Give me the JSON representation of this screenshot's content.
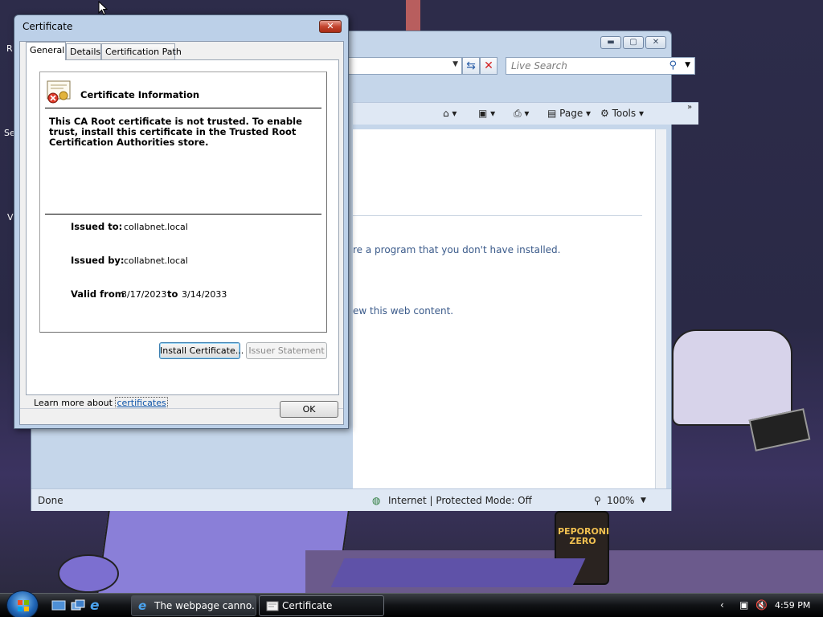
{
  "desktop": {
    "icon_labels": [
      "R",
      "Se",
      "V"
    ],
    "can_label": "PEPORONI ZERO"
  },
  "ie": {
    "search_placeholder": "Live Search",
    "commands": {
      "page": "Page",
      "tools": "Tools"
    },
    "content_lines": [
      "re a program that you don't have installed.",
      "ew this web content."
    ],
    "status": {
      "text": "Done",
      "zone": "Internet | Protected Mode: Off",
      "zoom": "100%"
    }
  },
  "certificate": {
    "title": "Certificate",
    "tabs": [
      "General",
      "Details",
      "Certification Path"
    ],
    "active_tab": "General",
    "heading": "Certificate Information",
    "warning": "This CA Root certificate is not trusted. To enable trust, install this certificate in the Trusted Root Certification Authorities store.",
    "issued_to_label": "Issued to:",
    "issued_to": "collabnet.local",
    "issued_by_label": "Issued by:",
    "issued_by": "collabnet.local",
    "valid_from_label": "Valid from",
    "valid_from": "3/17/2023",
    "valid_to_label": "to",
    "valid_to": "3/14/2033",
    "install_button": "Install Certificate...",
    "issuer_button": "Issuer Statement",
    "learn_more_prefix": "Learn more about",
    "learn_more_link": "certificates",
    "ok_button": "OK"
  },
  "taskbar": {
    "tasks": [
      {
        "label": "The webpage canno...",
        "active": false
      },
      {
        "label": "Certificate",
        "active": true
      }
    ],
    "clock": "4:59 PM"
  }
}
